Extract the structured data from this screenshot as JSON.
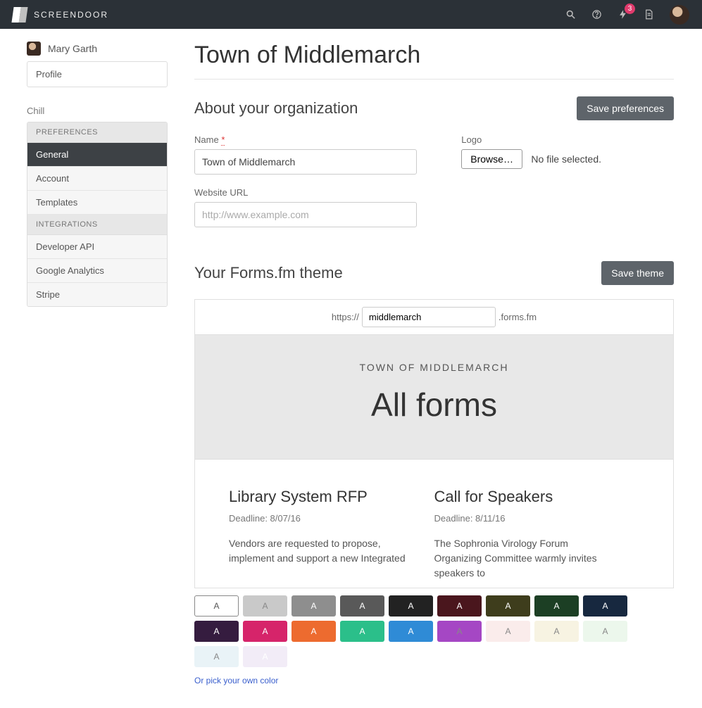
{
  "brand": "SCREENDOOR",
  "nav": {
    "notification_count": "3"
  },
  "user": {
    "name": "Mary Garth",
    "profile_link": "Profile"
  },
  "sidebar": {
    "org_label": "Chill",
    "headers": {
      "preferences": "PREFERENCES",
      "integrations": "INTEGRATIONS"
    },
    "items": {
      "general": "General",
      "account": "Account",
      "templates": "Templates",
      "developer_api": "Developer API",
      "google_analytics": "Google Analytics",
      "stripe": "Stripe"
    }
  },
  "page": {
    "title": "Town of Middlemarch"
  },
  "about": {
    "heading": "About your organization",
    "save_button": "Save preferences",
    "name_label": "Name",
    "required_mark": "*",
    "name_value": "Town of Middlemarch",
    "website_label": "Website URL",
    "website_placeholder": "http://www.example.com",
    "logo_label": "Logo",
    "browse_label": "Browse…",
    "file_status": "No file selected."
  },
  "theme": {
    "heading": "Your Forms.fm theme",
    "save_button": "Save theme",
    "url_prefix": "https://",
    "subdomain_value": "middlemarch",
    "url_suffix": ".forms.fm",
    "preview": {
      "org_upper": "TOWN OF MIDDLEMARCH",
      "title": "All forms",
      "cards": [
        {
          "title": "Library System RFP",
          "deadline": "Deadline: 8/07/16",
          "desc": "Vendors are requested to propose, implement and support a new Integrated"
        },
        {
          "title": "Call for Speakers",
          "deadline": "Deadline: 8/11/16",
          "desc": "The Sophronia Virology Forum Organizing Committee warmly invites speakers to"
        }
      ]
    },
    "swatch_letter": "A",
    "swatches_row1": [
      "#ffffff",
      "#c9c9c9",
      "#8e8e8e",
      "#595959",
      "#222222",
      "#4a161d",
      "#3e3d1c",
      "#1c3f24",
      "#17283f",
      "#351c3f"
    ],
    "swatches_row2": [
      "#d6246a",
      "#ed6b2f",
      "#2bbf8a",
      "#2f8bd6",
      "#a547c4",
      "#faeceb",
      "#f7f3e2",
      "#ecf7ec",
      "#e9f3f7",
      "#f2ecf7"
    ],
    "pick_color_label": "Or pick your own color"
  }
}
